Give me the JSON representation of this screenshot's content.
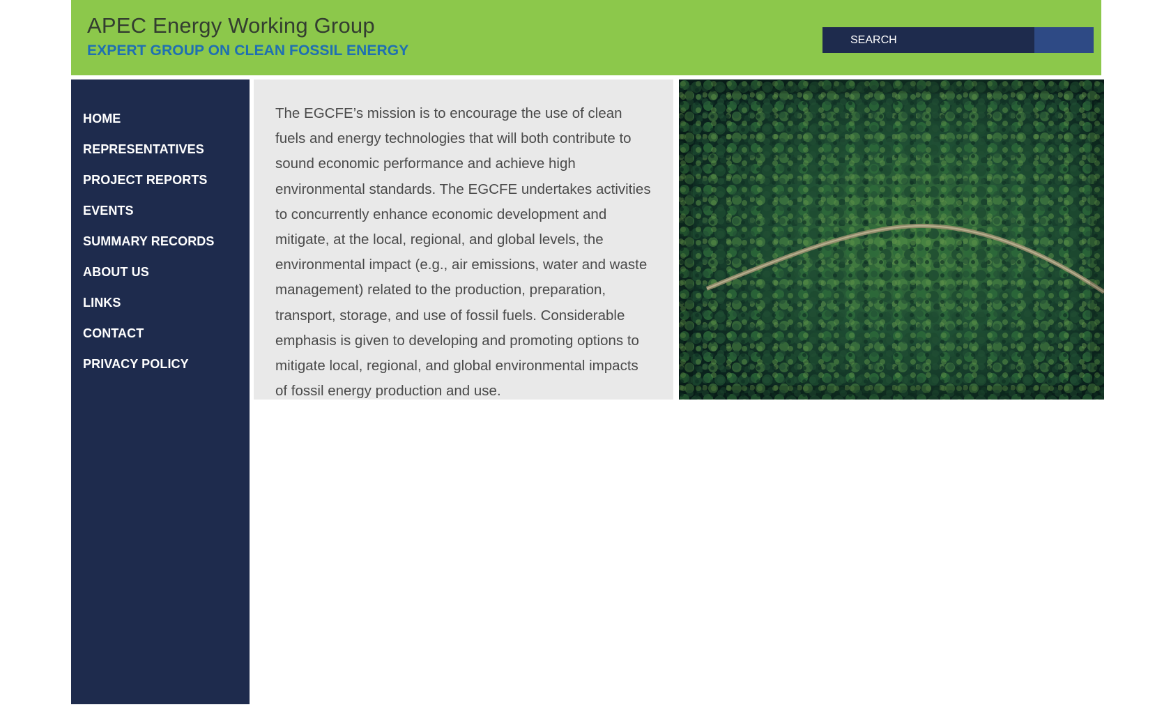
{
  "header": {
    "title": "APEC Energy Working Group",
    "subtitle": "EXPERT GROUP ON CLEAN FOSSIL ENERGY"
  },
  "search": {
    "placeholder": "SEARCH",
    "button_icon": "search-submit-icon"
  },
  "sidebar": {
    "items": [
      {
        "label": "HOME"
      },
      {
        "label": "REPRESENTATIVES"
      },
      {
        "label": "PROJECT REPORTS"
      },
      {
        "label": "EVENTS"
      },
      {
        "label": "SUMMARY RECORDS"
      },
      {
        "label": "ABOUT US"
      },
      {
        "label": "LINKS"
      },
      {
        "label": "CONTACT"
      },
      {
        "label": "PRIVACY POLICY"
      }
    ]
  },
  "main": {
    "mission_text": "The EGCFE’s mission is to encourage the use of clean fuels and energy technologies that will both contribute to sound economic performance and achieve high environmental standards. The EGCFE undertakes activities to concurrently enhance economic development and mitigate, at the local, regional, and global levels, the environmental impact (e.g., air emissions, water and waste management) related to the production, preparation, transport, storage, and use of fossil fuels. Considerable emphasis is given to developing and promoting options to mitigate local, regional, and global environmental impacts of fossil energy production and use."
  },
  "colors": {
    "header_bg": "#8cc84b",
    "title_text": "#333d30",
    "subtitle_text": "#1f6fb2",
    "sidebar_bg": "#1e2b4d",
    "search_input_bg": "#1e2b4d",
    "search_button_bg": "#2e4a85",
    "content_bg": "#e9e9e9",
    "content_text": "#4a4a4a"
  }
}
